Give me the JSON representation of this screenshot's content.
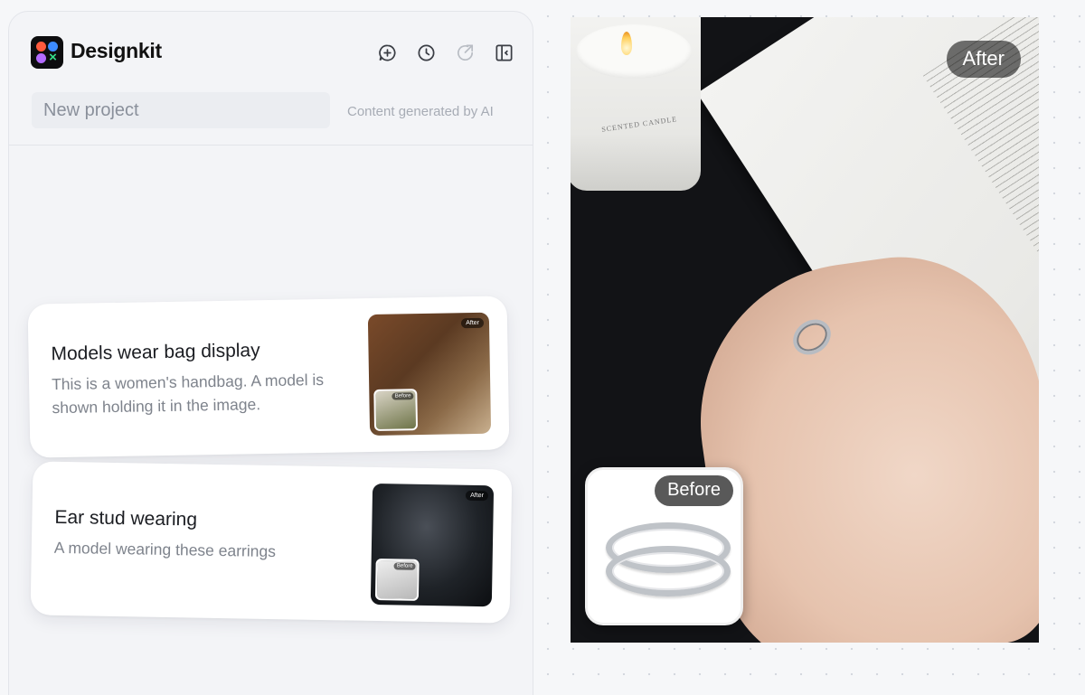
{
  "app": {
    "brand": "Designkit",
    "toolbar": [
      {
        "name": "new-project-icon"
      },
      {
        "name": "history-icon"
      },
      {
        "name": "share-icon"
      },
      {
        "name": "collapse-panel-icon"
      }
    ]
  },
  "project": {
    "name_placeholder": "New project",
    "ai_note": "Content generated by AI"
  },
  "cards": [
    {
      "title": "Models wear bag display",
      "description": "This is a women's handbag. A model is shown holding it in the image.",
      "thumb_after_label": "After",
      "thumb_before_label": "Before"
    },
    {
      "title": "Ear stud wearing",
      "description": "A model wearing these earrings",
      "thumb_after_label": "After",
      "thumb_before_label": "Before"
    }
  ],
  "preview": {
    "after_label": "After",
    "before_label": "Before",
    "candle_text": "SCENTED CANDLE"
  },
  "colors": {
    "panel_bg": "#f3f4f7",
    "card_bg": "#ffffff",
    "text_primary": "#1b1d22",
    "text_secondary": "#7e838c"
  }
}
